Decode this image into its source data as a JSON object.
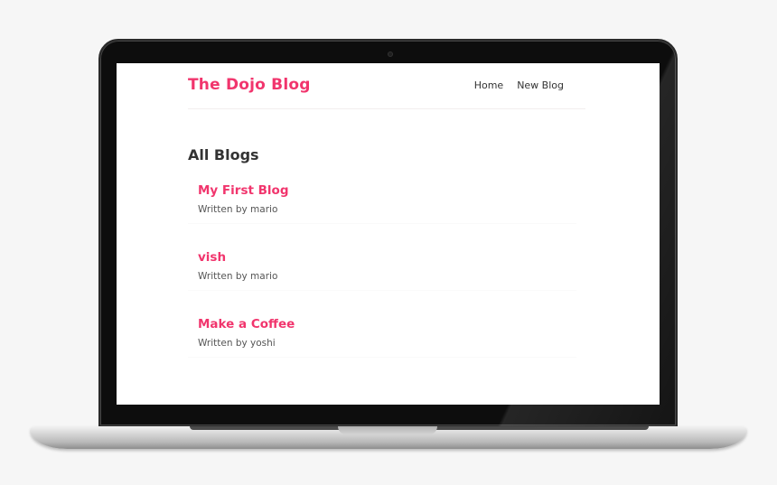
{
  "app": {
    "brand": "The Dojo Blog"
  },
  "nav": {
    "links": [
      {
        "label": "Home"
      },
      {
        "label": "New Blog"
      }
    ]
  },
  "main": {
    "title": "All Blogs",
    "blogs": [
      {
        "title": "My First Blog",
        "author": "Written by mario"
      },
      {
        "title": "vish",
        "author": "Written by mario"
      },
      {
        "title": "Make a Coffee",
        "author": "Written by yoshi"
      }
    ]
  },
  "colors": {
    "accent": "#f1356d",
    "text": "#333333",
    "background": "#ffffff"
  }
}
